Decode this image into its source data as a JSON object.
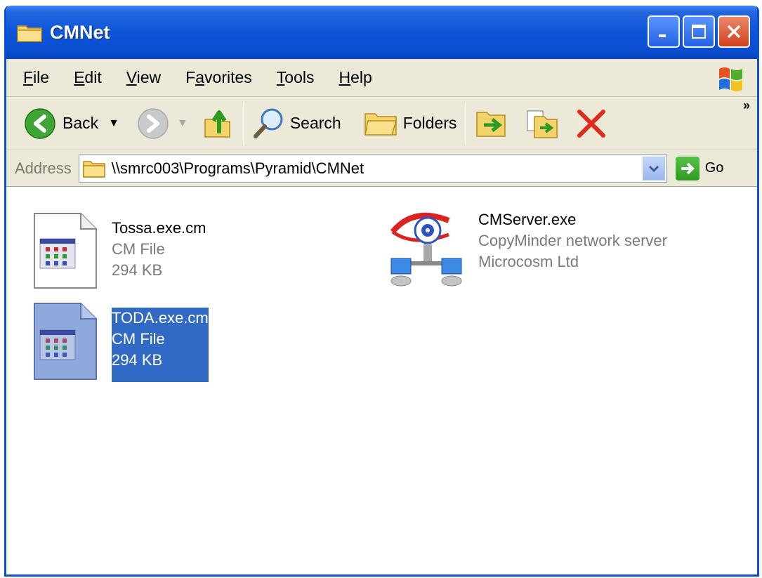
{
  "window": {
    "title": "CMNet",
    "title_icon": "folder-icon",
    "controls": [
      "minimize-icon",
      "maximize-icon",
      "close-icon"
    ]
  },
  "menubar": {
    "items": [
      {
        "label": "File",
        "accel": "F"
      },
      {
        "label": "Edit",
        "accel": "E"
      },
      {
        "label": "View",
        "accel": "V"
      },
      {
        "label": "Favorites",
        "accel": "a"
      },
      {
        "label": "Tools",
        "accel": "T"
      },
      {
        "label": "Help",
        "accel": "H"
      }
    ]
  },
  "toolbar": {
    "back_label": "Back",
    "search_label": "Search",
    "folders_label": "Folders",
    "overflow_label": "»"
  },
  "address": {
    "label": "Address",
    "value": "\\\\smrc003\\Programs\\Pyramid\\CMNet",
    "go_label": "Go"
  },
  "files": [
    {
      "name": "Tossa.exe.cm",
      "type": "CM File",
      "size": "294 KB",
      "icon": "cm-file-icon",
      "selected": false
    },
    {
      "name": "CMServer.exe",
      "type": "CopyMinder network server",
      "size": "Microcosm Ltd",
      "icon": "network-server-icon",
      "selected": false
    },
    {
      "name": "TODA.exe.cm",
      "type": "CM File",
      "size": "294 KB",
      "icon": "cm-file-icon",
      "selected": true
    }
  ],
  "colors": {
    "titlebar": "#0c55d9",
    "selection": "#316ac5",
    "chrome": "#ece9d8"
  }
}
